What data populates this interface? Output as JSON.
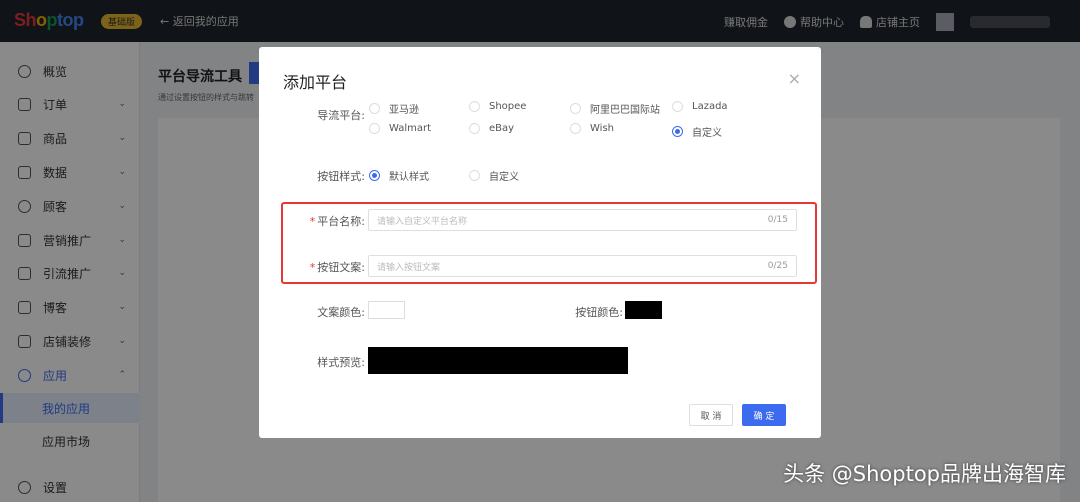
{
  "topbar": {
    "logo": "Shoptop",
    "badge": "基础版",
    "back": "返回我的应用",
    "commission": "赚取佣金",
    "help": "帮助中心",
    "store": "店铺主页"
  },
  "sidebar": {
    "items": [
      {
        "label": "概览"
      },
      {
        "label": "订单"
      },
      {
        "label": "商品"
      },
      {
        "label": "数据"
      },
      {
        "label": "顾客"
      },
      {
        "label": "营销推广"
      },
      {
        "label": "引流推广"
      },
      {
        "label": "博客"
      },
      {
        "label": "店铺装修"
      },
      {
        "label": "应用"
      }
    ],
    "sub": [
      {
        "label": "我的应用"
      },
      {
        "label": "应用市场"
      }
    ],
    "settings": "设置"
  },
  "page": {
    "title": "平台导流工具",
    "subtitle": "通过设置按钮的样式与跳转"
  },
  "modal": {
    "title": "添加平台",
    "close": "×",
    "platform_label": "导流平台:",
    "platforms": [
      "亚马逊",
      "Shopee",
      "阿里巴巴国际站",
      "Lazada",
      "Walmart",
      "eBay",
      "Wish",
      "自定义"
    ],
    "platform_selected": "自定义",
    "style_label": "按钮样式:",
    "styles": [
      "默认样式",
      "自定义"
    ],
    "name_label": "平台名称:",
    "name_placeholder": "请输入自定义平台名称",
    "name_count": "0/15",
    "text_label": "按钮文案:",
    "text_placeholder": "请输入按钮文案",
    "text_count": "0/25",
    "text_color_label": "文案颜色:",
    "btn_color_label": "按钮颜色:",
    "preview_label": "样式预览:",
    "cancel": "取 消",
    "confirm": "确 定"
  },
  "colors": {
    "text_color": "#ffffff",
    "button_color": "#000000",
    "accent": "#3d6bf0"
  },
  "watermark": "头条 @Shoptop品牌出海智库"
}
